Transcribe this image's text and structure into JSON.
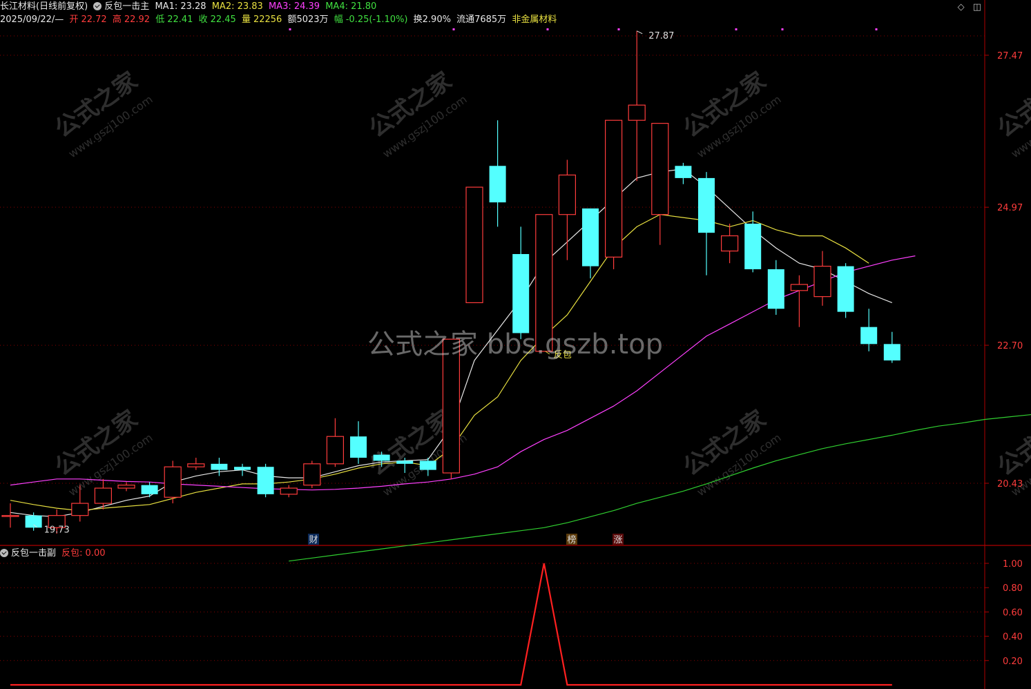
{
  "header": {
    "stock_name": "长江材料(日线前复权)",
    "indicator_main": "反包一击主",
    "ma1": "MA1: 23.28",
    "ma2": "MA2: 23.83",
    "ma3": "MA3: 24.39",
    "ma4": "MA4: 21.80",
    "date": "2025/09/22/—",
    "open_label": "开",
    "open": "22.72",
    "high_label": "高",
    "high": "22.92",
    "low_label": "低",
    "low": "22.41",
    "close_label": "收",
    "close": "22.45",
    "vol_label": "量",
    "vol": "22256",
    "amount": "额5023万",
    "change_label": "幅",
    "change": "-0.25(-1.10%)",
    "turnover": "换2.90%",
    "float": "流通7685万",
    "sector": "非金属材料",
    "icons": [
      "diamond-icon",
      "window-icon"
    ]
  },
  "main_axis": {
    "ticks": [
      "27.47",
      "24.97",
      "22.70",
      "20.43"
    ]
  },
  "annotations": {
    "high_marker": "27.87",
    "low_marker": "19.73",
    "signal_label": "反包",
    "badge_cai": "财",
    "badge_bang": "榜",
    "badge_zhang": "涨"
  },
  "watermark": {
    "center": "公式之家 bbs.gszb.top",
    "tile_cn": "公式之家",
    "tile_url": "www.gszj100.com"
  },
  "sub_panel": {
    "title": "反包一击副",
    "series_label": "反包:",
    "series_value": "0.00",
    "ticks": [
      "1.00",
      "0.80",
      "0.60",
      "0.40",
      "0.20"
    ]
  },
  "colors": {
    "up": "#ff3c3c",
    "down": "#54ffff",
    "ma1": "#e8e8e8",
    "ma2": "#e8e040",
    "ma3": "#ff40ff",
    "ma4": "#30d030",
    "grid": "#8b0000"
  },
  "chart_data": [
    {
      "type": "candlestick",
      "title": "长江材料(日线前复权)",
      "y_ticks": [
        27.47,
        24.97,
        22.7,
        20.43
      ],
      "ylim": [
        19.0,
        28.0
      ],
      "candles": [
        {
          "o": 19.9,
          "c": 19.9,
          "h": 20.1,
          "l": 19.7
        },
        {
          "o": 19.9,
          "c": 19.7,
          "h": 19.95,
          "l": 19.65
        },
        {
          "o": 19.7,
          "c": 19.9,
          "h": 20.0,
          "l": 19.6
        },
        {
          "o": 19.9,
          "c": 20.1,
          "h": 20.4,
          "l": 19.8
        },
        {
          "o": 20.1,
          "c": 20.35,
          "h": 20.5,
          "l": 20.0
        },
        {
          "o": 20.35,
          "c": 20.4,
          "h": 20.45,
          "l": 20.3
        },
        {
          "o": 20.4,
          "c": 20.25,
          "h": 20.45,
          "l": 20.2
        },
        {
          "o": 20.2,
          "c": 20.7,
          "h": 20.8,
          "l": 20.1
        },
        {
          "o": 20.7,
          "c": 20.75,
          "h": 20.85,
          "l": 20.65
        },
        {
          "o": 20.75,
          "c": 20.65,
          "h": 20.85,
          "l": 20.55
        },
        {
          "o": 20.7,
          "c": 20.65,
          "h": 20.75,
          "l": 20.55
        },
        {
          "o": 20.7,
          "c": 20.25,
          "h": 20.75,
          "l": 20.2
        },
        {
          "o": 20.25,
          "c": 20.35,
          "h": 20.4,
          "l": 20.2
        },
        {
          "o": 20.4,
          "c": 20.75,
          "h": 20.8,
          "l": 20.35
        },
        {
          "o": 20.75,
          "c": 21.2,
          "h": 21.5,
          "l": 20.7
        },
        {
          "o": 21.2,
          "c": 20.85,
          "h": 21.45,
          "l": 20.75
        },
        {
          "o": 20.9,
          "c": 20.8,
          "h": 20.95,
          "l": 20.7
        },
        {
          "o": 20.8,
          "c": 20.75,
          "h": 20.85,
          "l": 20.6
        },
        {
          "o": 20.8,
          "c": 20.65,
          "h": 20.85,
          "l": 20.55
        },
        {
          "o": 20.6,
          "c": 22.8,
          "h": 22.8,
          "l": 20.5
        },
        {
          "o": 23.4,
          "c": 25.3,
          "h": 25.3,
          "l": 23.4
        },
        {
          "o": 25.65,
          "c": 25.05,
          "h": 26.4,
          "l": 24.65
        },
        {
          "o": 24.2,
          "c": 22.9,
          "h": 24.65,
          "l": 22.8
        },
        {
          "o": 22.6,
          "c": 24.85,
          "h": 24.85,
          "l": 22.6
        },
        {
          "o": 24.85,
          "c": 25.5,
          "h": 25.75,
          "l": 24.1
        },
        {
          "o": 24.95,
          "c": 24.0,
          "h": 24.95,
          "l": 23.8
        },
        {
          "o": 24.15,
          "c": 26.4,
          "h": 26.4,
          "l": 23.95
        },
        {
          "o": 26.4,
          "c": 26.65,
          "h": 27.87,
          "l": 25.4
        },
        {
          "o": 24.85,
          "c": 26.35,
          "h": 26.35,
          "l": 24.35
        },
        {
          "o": 25.65,
          "c": 25.45,
          "h": 25.7,
          "l": 25.35
        },
        {
          "o": 25.45,
          "c": 24.55,
          "h": 25.55,
          "l": 23.85
        },
        {
          "o": 24.25,
          "c": 24.5,
          "h": 24.7,
          "l": 24.05
        },
        {
          "o": 24.7,
          "c": 23.95,
          "h": 24.9,
          "l": 23.9
        },
        {
          "o": 23.95,
          "c": 23.3,
          "h": 24.1,
          "l": 23.2
        },
        {
          "o": 23.6,
          "c": 23.7,
          "h": 23.85,
          "l": 23.0
        },
        {
          "o": 23.5,
          "c": 24.0,
          "h": 24.25,
          "l": 23.35
        },
        {
          "o": 24.0,
          "c": 23.25,
          "h": 24.05,
          "l": 23.15
        },
        {
          "o": 23.0,
          "c": 22.72,
          "h": 23.3,
          "l": 22.6
        },
        {
          "o": 22.72,
          "c": 22.45,
          "h": 22.92,
          "l": 22.41
        }
      ],
      "series": [
        {
          "name": "MA1",
          "values": [
            19.95,
            19.9,
            19.88,
            19.95,
            20.05,
            20.15,
            20.22,
            20.45,
            20.55,
            20.62,
            20.65,
            20.55,
            20.52,
            20.52,
            20.62,
            20.72,
            20.78,
            20.8,
            20.82,
            21.35,
            22.45,
            22.95,
            23.45,
            24.05,
            24.4,
            24.75,
            25.1,
            25.45,
            25.55,
            25.6,
            25.3,
            24.95,
            24.6,
            24.3,
            24.05,
            23.95,
            23.75,
            23.55,
            23.4
          ]
        },
        {
          "name": "MA2",
          "values": [
            20.15,
            20.08,
            20.02,
            19.98,
            20.02,
            20.05,
            20.08,
            20.18,
            20.28,
            20.35,
            20.42,
            20.42,
            20.45,
            20.5,
            20.58,
            20.68,
            20.75,
            20.78,
            20.72,
            21.0,
            21.55,
            21.85,
            22.45,
            22.85,
            23.2,
            23.75,
            24.3,
            24.65,
            24.85,
            24.8,
            24.75,
            24.65,
            24.75,
            24.6,
            24.5,
            24.5,
            24.3,
            24.05
          ]
        },
        {
          "name": "MA3",
          "values": [
            20.4,
            20.45,
            20.5,
            20.5,
            20.48,
            20.46,
            20.45,
            20.42,
            20.4,
            20.38,
            20.36,
            20.34,
            20.33,
            20.32,
            20.33,
            20.35,
            20.38,
            20.42,
            20.45,
            20.5,
            20.58,
            20.7,
            20.95,
            21.15,
            21.3,
            21.5,
            21.7,
            21.95,
            22.25,
            22.55,
            22.85,
            23.05,
            23.25,
            23.45,
            23.6,
            23.75,
            23.9,
            24.0,
            24.1,
            24.17
          ]
        },
        {
          "name": "MA4",
          "values": [
            19.15,
            19.2,
            19.25,
            19.3,
            19.35,
            19.4,
            19.45,
            19.5,
            19.55,
            19.6,
            19.65,
            19.7,
            19.78,
            19.88,
            19.98,
            20.1,
            20.2,
            20.3,
            20.42,
            20.55,
            20.68,
            20.8,
            20.9,
            21.0,
            21.08,
            21.15,
            21.22,
            21.3,
            21.37,
            21.42,
            21.48,
            21.52,
            21.56,
            21.6,
            21.64,
            21.67
          ]
        }
      ]
    },
    {
      "type": "line",
      "title": "反包一击副",
      "y_ticks": [
        1.0,
        0.8,
        0.6,
        0.4,
        0.2
      ],
      "ylim": [
        0,
        1.0
      ],
      "series": [
        {
          "name": "反包",
          "values": [
            0,
            0,
            0,
            0,
            0,
            0,
            0,
            0,
            0,
            0,
            0,
            0,
            0,
            0,
            0,
            0,
            0,
            0,
            0,
            0,
            0,
            0,
            0,
            1,
            0,
            0,
            0,
            0,
            0,
            0,
            0,
            0,
            0,
            0,
            0,
            0,
            0,
            0,
            0
          ]
        }
      ]
    }
  ]
}
